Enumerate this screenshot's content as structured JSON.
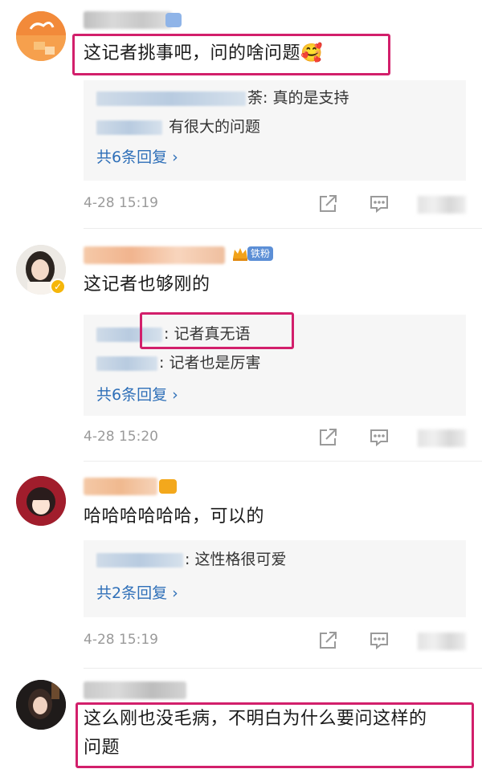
{
  "comments": [
    {
      "text": "这记者挑事吧，问的啥问题🥰",
      "replies": [
        {
          "suffix": "荼: 真的是支持"
        },
        {
          "suffix": "有很大的问题"
        }
      ],
      "more_replies": "共6条回复 ›",
      "time": "4-28 15:19"
    },
    {
      "text": "这记者也够刚的",
      "badge": "铁粉",
      "replies": [
        {
          "suffix": ": 记者真无语"
        },
        {
          "suffix": ": 记者也是厉害"
        }
      ],
      "more_replies": "共6条回复 ›",
      "time": "4-28 15:20"
    },
    {
      "text": "哈哈哈哈哈哈，可以的",
      "replies": [
        {
          "suffix": ": 这性格很可爱"
        }
      ],
      "more_replies": "共2条回复 ›",
      "time": "4-28 15:19"
    },
    {
      "text_line1": "这么刚也没毛病，不明白为什么要问这样的",
      "text_line2": "问题"
    }
  ],
  "icons": {
    "share": "share-icon",
    "comment": "comment-icon",
    "like": "like-icon"
  },
  "colors": {
    "link": "#2e6fb8",
    "highlight": "#d21f6b",
    "time": "#9a9a9a",
    "reply_bg": "#f6f6f6"
  }
}
